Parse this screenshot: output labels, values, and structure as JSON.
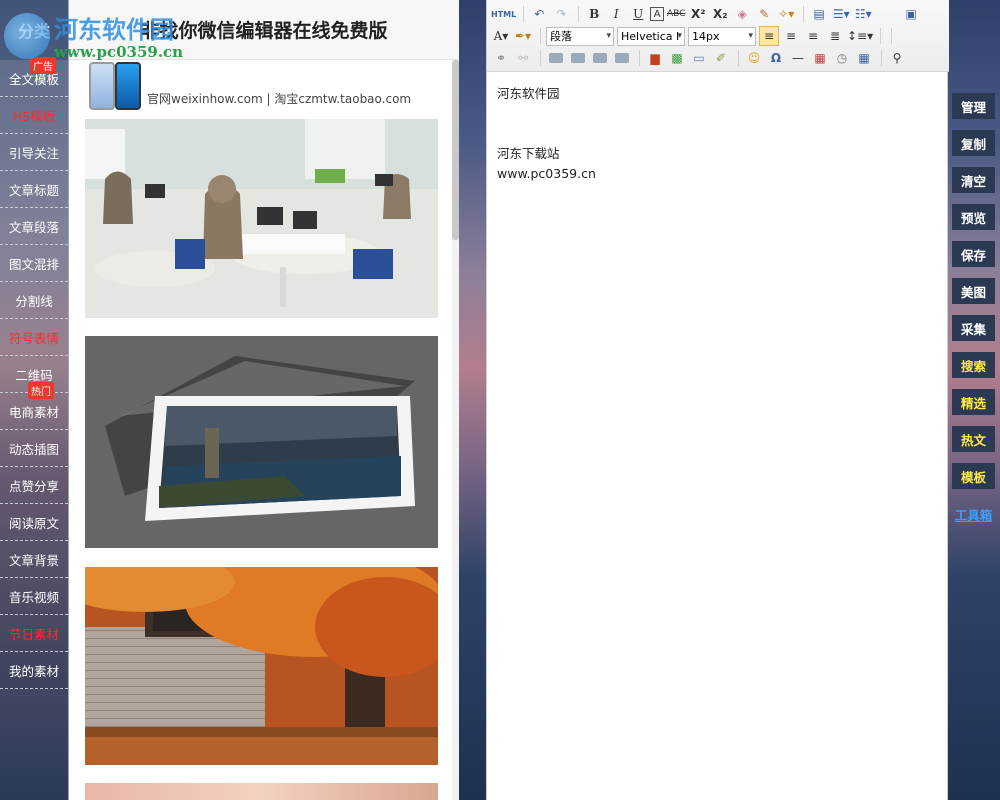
{
  "watermark": {
    "site": "河东软件园",
    "url": "www.pc0359.cn"
  },
  "left_nav": {
    "header": "分类",
    "items": [
      {
        "label": "全文模板",
        "red": false,
        "badge": "广告"
      },
      {
        "label": "H5模板",
        "red": true,
        "badge": ""
      },
      {
        "label": "引导关注",
        "red": false,
        "badge": ""
      },
      {
        "label": "文章标题",
        "red": false,
        "badge": ""
      },
      {
        "label": "文章段落",
        "red": false,
        "badge": ""
      },
      {
        "label": "图文混排",
        "red": false,
        "badge": ""
      },
      {
        "label": "分割线",
        "red": false,
        "badge": ""
      },
      {
        "label": "符号表情",
        "red": true,
        "badge": ""
      },
      {
        "label": "二维码",
        "red": false,
        "badge": "热门"
      },
      {
        "label": "电商素材",
        "red": false,
        "badge": ""
      },
      {
        "label": "动态插图",
        "red": false,
        "badge": ""
      },
      {
        "label": "点赞分享",
        "red": false,
        "badge": ""
      },
      {
        "label": "阅读原文",
        "red": false,
        "badge": ""
      },
      {
        "label": "文章背景",
        "red": false,
        "badge": ""
      },
      {
        "label": "音乐视频",
        "red": false,
        "badge": ""
      },
      {
        "label": "节日素材",
        "red": true,
        "badge": ""
      },
      {
        "label": "我的素材",
        "red": false,
        "badge": ""
      }
    ]
  },
  "middle": {
    "title": "非找你微信编辑器在线免费版",
    "ad_text": "官网weixinhow.com | 淘宝czmtw.taobao.com"
  },
  "toolbar": {
    "html_label": "HTML",
    "format_select": "段落",
    "font_select": "Helvetica I",
    "size_select": "14px"
  },
  "editor": {
    "lines": [
      "河东软件园",
      "",
      "河东下载站",
      "www.pc0359.cn"
    ]
  },
  "right_bar": {
    "buttons": [
      {
        "label": "管理",
        "style": "white"
      },
      {
        "label": "复制",
        "style": "white"
      },
      {
        "label": "清空",
        "style": "white"
      },
      {
        "label": "预览",
        "style": "white"
      },
      {
        "label": "保存",
        "style": "white"
      },
      {
        "label": "美图",
        "style": "white"
      },
      {
        "label": "采集",
        "style": "white"
      },
      {
        "label": "搜索",
        "style": "yellow"
      },
      {
        "label": "精选",
        "style": "yellow"
      },
      {
        "label": "热文",
        "style": "yellow"
      },
      {
        "label": "模板",
        "style": "yellow"
      },
      {
        "label": "工具箱",
        "style": "blue"
      }
    ]
  }
}
